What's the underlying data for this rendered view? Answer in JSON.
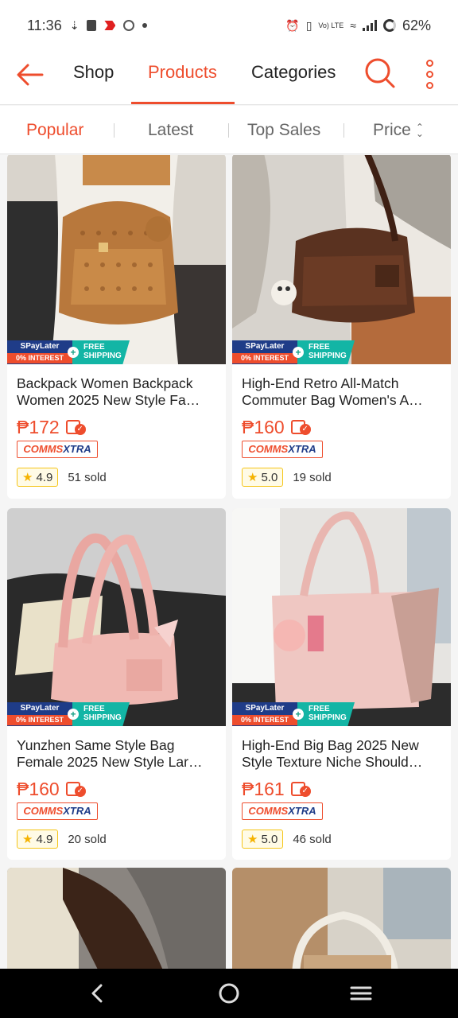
{
  "status_bar": {
    "time": "11:36",
    "battery": "62%",
    "network_label": "Vo) LTE"
  },
  "top_nav": {
    "tabs": [
      {
        "label": "Shop",
        "active": false
      },
      {
        "label": "Products",
        "active": true
      },
      {
        "label": "Categories",
        "active": false
      }
    ]
  },
  "sort_bar": {
    "items": [
      {
        "label": "Popular",
        "active": true
      },
      {
        "label": "Latest",
        "active": false
      },
      {
        "label": "Top Sales",
        "active": false
      },
      {
        "label": "Price",
        "active": false
      }
    ]
  },
  "badges": {
    "spaylater": "SPayLater",
    "interest": "0% INTEREST",
    "free": "FREE",
    "shipping": "SHIPPING",
    "comms_left": "COMMS",
    "comms_right": "XTRA"
  },
  "products": [
    {
      "title_line1": "Backpack Women Backpack",
      "title_line2": "Women 2025 New Style Fa…",
      "price": "₱172",
      "rating": "4.9",
      "sold": "51 sold"
    },
    {
      "title_line1": "High-End Retro All-Match",
      "title_line2": "Commuter Bag Women's A…",
      "price": "₱160",
      "rating": "5.0",
      "sold": "19 sold"
    },
    {
      "title_line1": "Yunzhen Same Style Bag",
      "title_line2": "Female 2025 New Style Lar…",
      "price": "₱160",
      "rating": "4.9",
      "sold": "20 sold"
    },
    {
      "title_line1": "High-End Big Bag 2025 New",
      "title_line2": "Style Texture Niche Should…",
      "price": "₱161",
      "rating": "5.0",
      "sold": "46 sold"
    }
  ],
  "colors": {
    "accent": "#ee4d2d",
    "spaylater_blue": "#1f3c88",
    "free_shipping_teal": "#13b5a5"
  }
}
